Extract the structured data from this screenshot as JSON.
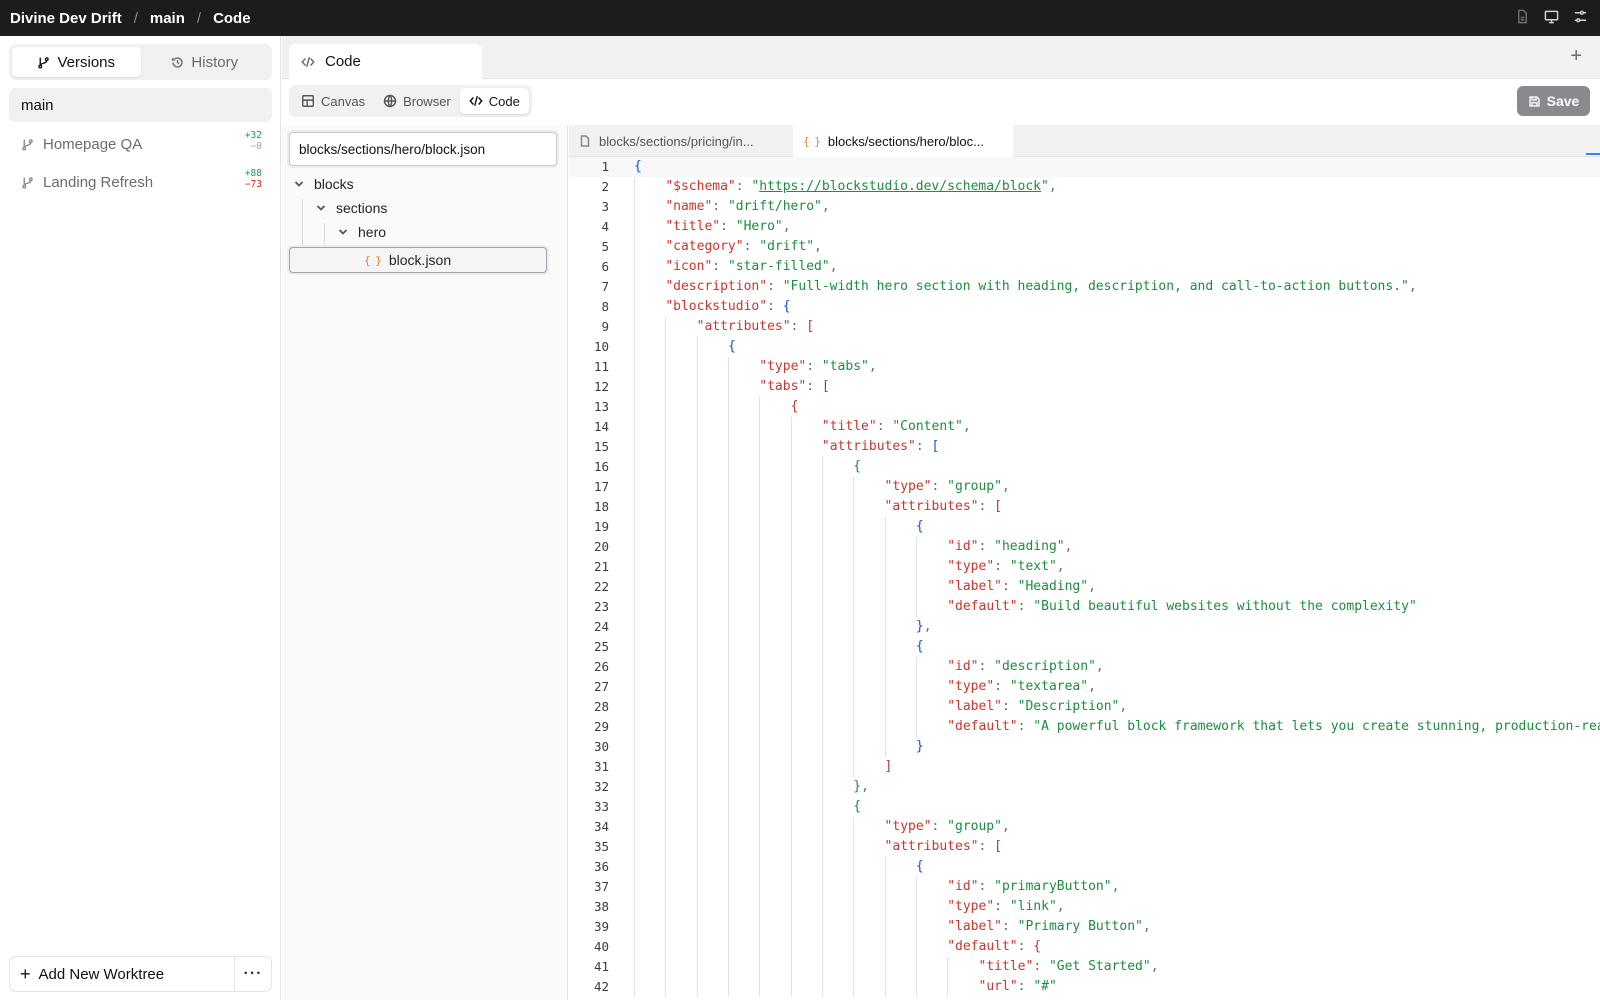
{
  "breadcrumbs": [
    "Divine Dev Drift",
    "main",
    "Code"
  ],
  "sidebar": {
    "tabs": [
      {
        "label": "Versions",
        "icon": "git-branch-icon",
        "active": true
      },
      {
        "label": "History",
        "icon": "history-icon",
        "active": false
      }
    ],
    "current_branch": "main",
    "worktrees": [
      {
        "name": "Homepage QA",
        "added": "+32",
        "removed": "−0"
      },
      {
        "name": "Landing Refresh",
        "added": "+88",
        "removed": "−73"
      }
    ],
    "add_button": "Add New Worktree",
    "more_button": "···"
  },
  "main_tab": {
    "label": "Code"
  },
  "modes": [
    {
      "label": "Canvas",
      "icon": "layout-icon"
    },
    {
      "label": "Browser",
      "icon": "globe-icon"
    },
    {
      "label": "Code",
      "icon": "code-icon",
      "active": true
    }
  ],
  "save_label": "Save",
  "file_tree": {
    "path_value": "blocks/sections/hero/block.json",
    "nodes": [
      {
        "label": "blocks",
        "type": "folder",
        "depth": 0
      },
      {
        "label": "sections",
        "type": "folder",
        "depth": 1
      },
      {
        "label": "hero",
        "type": "folder",
        "depth": 2
      },
      {
        "label": "block.json",
        "type": "json-file",
        "depth": 3,
        "selected": true
      }
    ]
  },
  "editor_tabs": [
    {
      "label": "blocks/sections/pricing/in...",
      "icon": "file-icon",
      "active": false
    },
    {
      "label": "blocks/sections/hero/bloc...",
      "icon": "json-icon",
      "active": true
    }
  ],
  "code_lines": [
    {
      "n": 1,
      "d": 0,
      "t": [
        [
          "b",
          "{"
        ]
      ]
    },
    {
      "n": 2,
      "d": 1,
      "t": [
        [
          "k",
          "\"$schema\""
        ],
        [
          "p",
          ": "
        ],
        [
          "s",
          "\""
        ],
        [
          "u",
          "https://blockstudio.dev/schema/block"
        ],
        [
          "s",
          "\""
        ],
        [
          "p",
          ","
        ]
      ]
    },
    {
      "n": 3,
      "d": 1,
      "t": [
        [
          "k",
          "\"name\""
        ],
        [
          "p",
          ": "
        ],
        [
          "s",
          "\"drift/hero\""
        ],
        [
          "p",
          ","
        ]
      ]
    },
    {
      "n": 4,
      "d": 1,
      "t": [
        [
          "k",
          "\"title\""
        ],
        [
          "p",
          ": "
        ],
        [
          "s",
          "\"Hero\""
        ],
        [
          "p",
          ","
        ]
      ]
    },
    {
      "n": 5,
      "d": 1,
      "t": [
        [
          "k",
          "\"category\""
        ],
        [
          "p",
          ": "
        ],
        [
          "s",
          "\"drift\""
        ],
        [
          "p",
          ","
        ]
      ]
    },
    {
      "n": 6,
      "d": 1,
      "t": [
        [
          "k",
          "\"icon\""
        ],
        [
          "p",
          ": "
        ],
        [
          "s",
          "\"star-filled\""
        ],
        [
          "p",
          ","
        ]
      ]
    },
    {
      "n": 7,
      "d": 1,
      "t": [
        [
          "k",
          "\"description\""
        ],
        [
          "p",
          ": "
        ],
        [
          "s",
          "\"Full-width hero section with heading, description, and call-to-action buttons.\""
        ],
        [
          "p",
          ","
        ]
      ]
    },
    {
      "n": 8,
      "d": 1,
      "t": [
        [
          "k",
          "\"blockstudio\""
        ],
        [
          "p",
          ": "
        ],
        [
          "b",
          "{"
        ]
      ]
    },
    {
      "n": 9,
      "d": 2,
      "t": [
        [
          "k",
          "\"attributes\""
        ],
        [
          "p",
          ": "
        ],
        [
          "br",
          "["
        ]
      ]
    },
    {
      "n": 10,
      "d": 3,
      "t": [
        [
          "b",
          "{"
        ]
      ]
    },
    {
      "n": 11,
      "d": 4,
      "t": [
        [
          "k",
          "\"type\""
        ],
        [
          "p",
          ": "
        ],
        [
          "s",
          "\"tabs\""
        ],
        [
          "p",
          ","
        ]
      ]
    },
    {
      "n": 12,
      "d": 4,
      "t": [
        [
          "k",
          "\"tabs\""
        ],
        [
          "p",
          ": "
        ],
        [
          "br",
          "["
        ]
      ]
    },
    {
      "n": 13,
      "d": 5,
      "t": [
        [
          "br",
          "{"
        ]
      ]
    },
    {
      "n": 14,
      "d": 6,
      "t": [
        [
          "k",
          "\"title\""
        ],
        [
          "p",
          ": "
        ],
        [
          "s",
          "\"Content\""
        ],
        [
          "p",
          ","
        ]
      ]
    },
    {
      "n": 15,
      "d": 6,
      "t": [
        [
          "k",
          "\"attributes\""
        ],
        [
          "p",
          ": "
        ],
        [
          "b",
          "["
        ]
      ]
    },
    {
      "n": 16,
      "d": 7,
      "t": [
        [
          "s",
          "{"
        ]
      ]
    },
    {
      "n": 17,
      "d": 8,
      "t": [
        [
          "k",
          "\"type\""
        ],
        [
          "p",
          ": "
        ],
        [
          "s",
          "\"group\""
        ],
        [
          "p",
          ","
        ]
      ]
    },
    {
      "n": 18,
      "d": 8,
      "t": [
        [
          "k",
          "\"attributes\""
        ],
        [
          "p",
          ": "
        ],
        [
          "br",
          "["
        ]
      ]
    },
    {
      "n": 19,
      "d": 9,
      "t": [
        [
          "b",
          "{"
        ]
      ]
    },
    {
      "n": 20,
      "d": 10,
      "t": [
        [
          "k",
          "\"id\""
        ],
        [
          "p",
          ": "
        ],
        [
          "s",
          "\"heading\""
        ],
        [
          "p",
          ","
        ]
      ]
    },
    {
      "n": 21,
      "d": 10,
      "t": [
        [
          "k",
          "\"type\""
        ],
        [
          "p",
          ": "
        ],
        [
          "s",
          "\"text\""
        ],
        [
          "p",
          ","
        ]
      ]
    },
    {
      "n": 22,
      "d": 10,
      "t": [
        [
          "k",
          "\"label\""
        ],
        [
          "p",
          ": "
        ],
        [
          "s",
          "\"Heading\""
        ],
        [
          "p",
          ","
        ]
      ]
    },
    {
      "n": 23,
      "d": 10,
      "t": [
        [
          "k",
          "\"default\""
        ],
        [
          "p",
          ": "
        ],
        [
          "s",
          "\"Build beautiful websites without the complexity\""
        ]
      ]
    },
    {
      "n": 24,
      "d": 9,
      "t": [
        [
          "b",
          "}"
        ],
        [
          "p",
          ","
        ]
      ]
    },
    {
      "n": 25,
      "d": 9,
      "t": [
        [
          "b",
          "{"
        ]
      ]
    },
    {
      "n": 26,
      "d": 10,
      "t": [
        [
          "k",
          "\"id\""
        ],
        [
          "p",
          ": "
        ],
        [
          "s",
          "\"description\""
        ],
        [
          "p",
          ","
        ]
      ]
    },
    {
      "n": 27,
      "d": 10,
      "t": [
        [
          "k",
          "\"type\""
        ],
        [
          "p",
          ": "
        ],
        [
          "s",
          "\"textarea\""
        ],
        [
          "p",
          ","
        ]
      ]
    },
    {
      "n": 28,
      "d": 10,
      "t": [
        [
          "k",
          "\"label\""
        ],
        [
          "p",
          ": "
        ],
        [
          "s",
          "\"Description\""
        ],
        [
          "p",
          ","
        ]
      ]
    },
    {
      "n": 29,
      "d": 10,
      "t": [
        [
          "k",
          "\"default\""
        ],
        [
          "p",
          ": "
        ],
        [
          "s",
          "\"A powerful block framework that lets you create stunning, production-rea"
        ]
      ]
    },
    {
      "n": 30,
      "d": 9,
      "t": [
        [
          "b",
          "}"
        ]
      ]
    },
    {
      "n": 31,
      "d": 8,
      "t": [
        [
          "br",
          "]"
        ]
      ]
    },
    {
      "n": 32,
      "d": 7,
      "t": [
        [
          "s",
          "}"
        ],
        [
          "p",
          ","
        ]
      ]
    },
    {
      "n": 33,
      "d": 7,
      "t": [
        [
          "s",
          "{"
        ]
      ]
    },
    {
      "n": 34,
      "d": 8,
      "t": [
        [
          "k",
          "\"type\""
        ],
        [
          "p",
          ": "
        ],
        [
          "s",
          "\"group\""
        ],
        [
          "p",
          ","
        ]
      ]
    },
    {
      "n": 35,
      "d": 8,
      "t": [
        [
          "k",
          "\"attributes\""
        ],
        [
          "p",
          ": "
        ],
        [
          "br",
          "["
        ]
      ]
    },
    {
      "n": 36,
      "d": 9,
      "t": [
        [
          "b",
          "{"
        ]
      ]
    },
    {
      "n": 37,
      "d": 10,
      "t": [
        [
          "k",
          "\"id\""
        ],
        [
          "p",
          ": "
        ],
        [
          "s",
          "\"primaryButton\""
        ],
        [
          "p",
          ","
        ]
      ]
    },
    {
      "n": 38,
      "d": 10,
      "t": [
        [
          "k",
          "\"type\""
        ],
        [
          "p",
          ": "
        ],
        [
          "s",
          "\"link\""
        ],
        [
          "p",
          ","
        ]
      ]
    },
    {
      "n": 39,
      "d": 10,
      "t": [
        [
          "k",
          "\"label\""
        ],
        [
          "p",
          ": "
        ],
        [
          "s",
          "\"Primary Button\""
        ],
        [
          "p",
          ","
        ]
      ]
    },
    {
      "n": 40,
      "d": 10,
      "t": [
        [
          "k",
          "\"default\""
        ],
        [
          "p",
          ": "
        ],
        [
          "br",
          "{"
        ]
      ]
    },
    {
      "n": 41,
      "d": 11,
      "t": [
        [
          "k",
          "\"title\""
        ],
        [
          "p",
          ": "
        ],
        [
          "s",
          "\"Get Started\""
        ],
        [
          "p",
          ","
        ]
      ]
    },
    {
      "n": 42,
      "d": 11,
      "t": [
        [
          "k",
          "\"url\""
        ],
        [
          "p",
          ": "
        ],
        [
          "s",
          "\"#\""
        ]
      ]
    }
  ],
  "colors": {
    "accent": "#3b82f6",
    "added": "#16a34a",
    "removed": "#dc2626",
    "json_key": "#d0342c",
    "json_string": "#1a8f3c",
    "json_brace": "#1650d8"
  }
}
